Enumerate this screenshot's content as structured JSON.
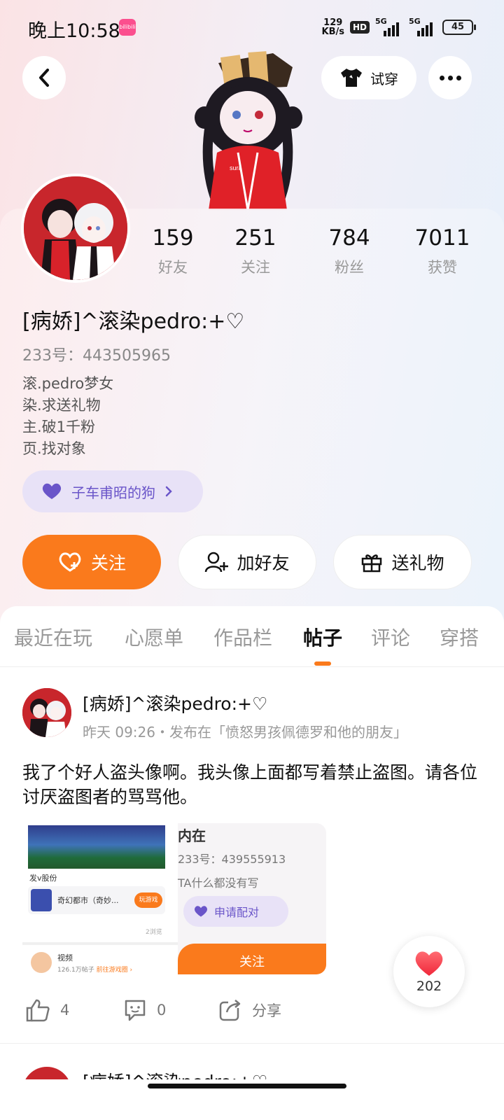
{
  "status_bar": {
    "time": "晚上10:58",
    "app_icon_label": "bilibili",
    "net_speed_top": "129",
    "net_speed_bottom": "KB/s",
    "hd_label": "HD",
    "net1": "5G",
    "net2": "5G",
    "battery": "45"
  },
  "header": {
    "tryon_label": "试穿"
  },
  "profile": {
    "stats": [
      {
        "value": "159",
        "label": "好友"
      },
      {
        "value": "251",
        "label": "关注"
      },
      {
        "value": "784",
        "label": "粉丝"
      },
      {
        "value": "7011",
        "label": "获赞"
      }
    ],
    "username": "[病娇]^滚染pedro:+♡",
    "uid": "233号：443505965",
    "bio": [
      "滚.pedro梦女",
      "染.求送礼物",
      "主.破1千粉",
      "页.找对象"
    ],
    "cp_label": "子车甫昭的狗",
    "actions": {
      "follow": "关注",
      "add_friend": "加好友",
      "gift": "送礼物"
    }
  },
  "tabs": [
    {
      "label": "最近在玩"
    },
    {
      "label": "心愿单"
    },
    {
      "label": "作品栏"
    },
    {
      "label": "帖子",
      "active": true
    },
    {
      "label": "评论"
    },
    {
      "label": "穿搭"
    }
  ],
  "post": {
    "author": "[病娇]^滚染pedro:+♡",
    "meta": "昨天 09:26・发布在「愤怒男孩佩德罗和他的朋友」",
    "text": "我了个好人盗头像啊。我头像上面都写着禁止盗图。请各位讨厌盗图者的骂骂他。",
    "screenshot_left": {
      "caption": "发v股份",
      "game_name": "奇幻都市（奇妙...",
      "play_button": "玩游戏",
      "views": "2浏览",
      "section": "视频",
      "section_sub": "126.1万帖子",
      "section_link": "前往游戏圈 ›"
    },
    "screenshot_right": {
      "title_fragment": "内在",
      "uid": "233号：439555913",
      "bio": "TA什么都没有写",
      "pair_button": "申请配对",
      "follow_button": "关注"
    },
    "likes": "4",
    "comments": "0",
    "share": "分享"
  },
  "floating_like": {
    "count": "202"
  },
  "next_post": {
    "author": "[病娇]^滚染pedro:+♡"
  }
}
